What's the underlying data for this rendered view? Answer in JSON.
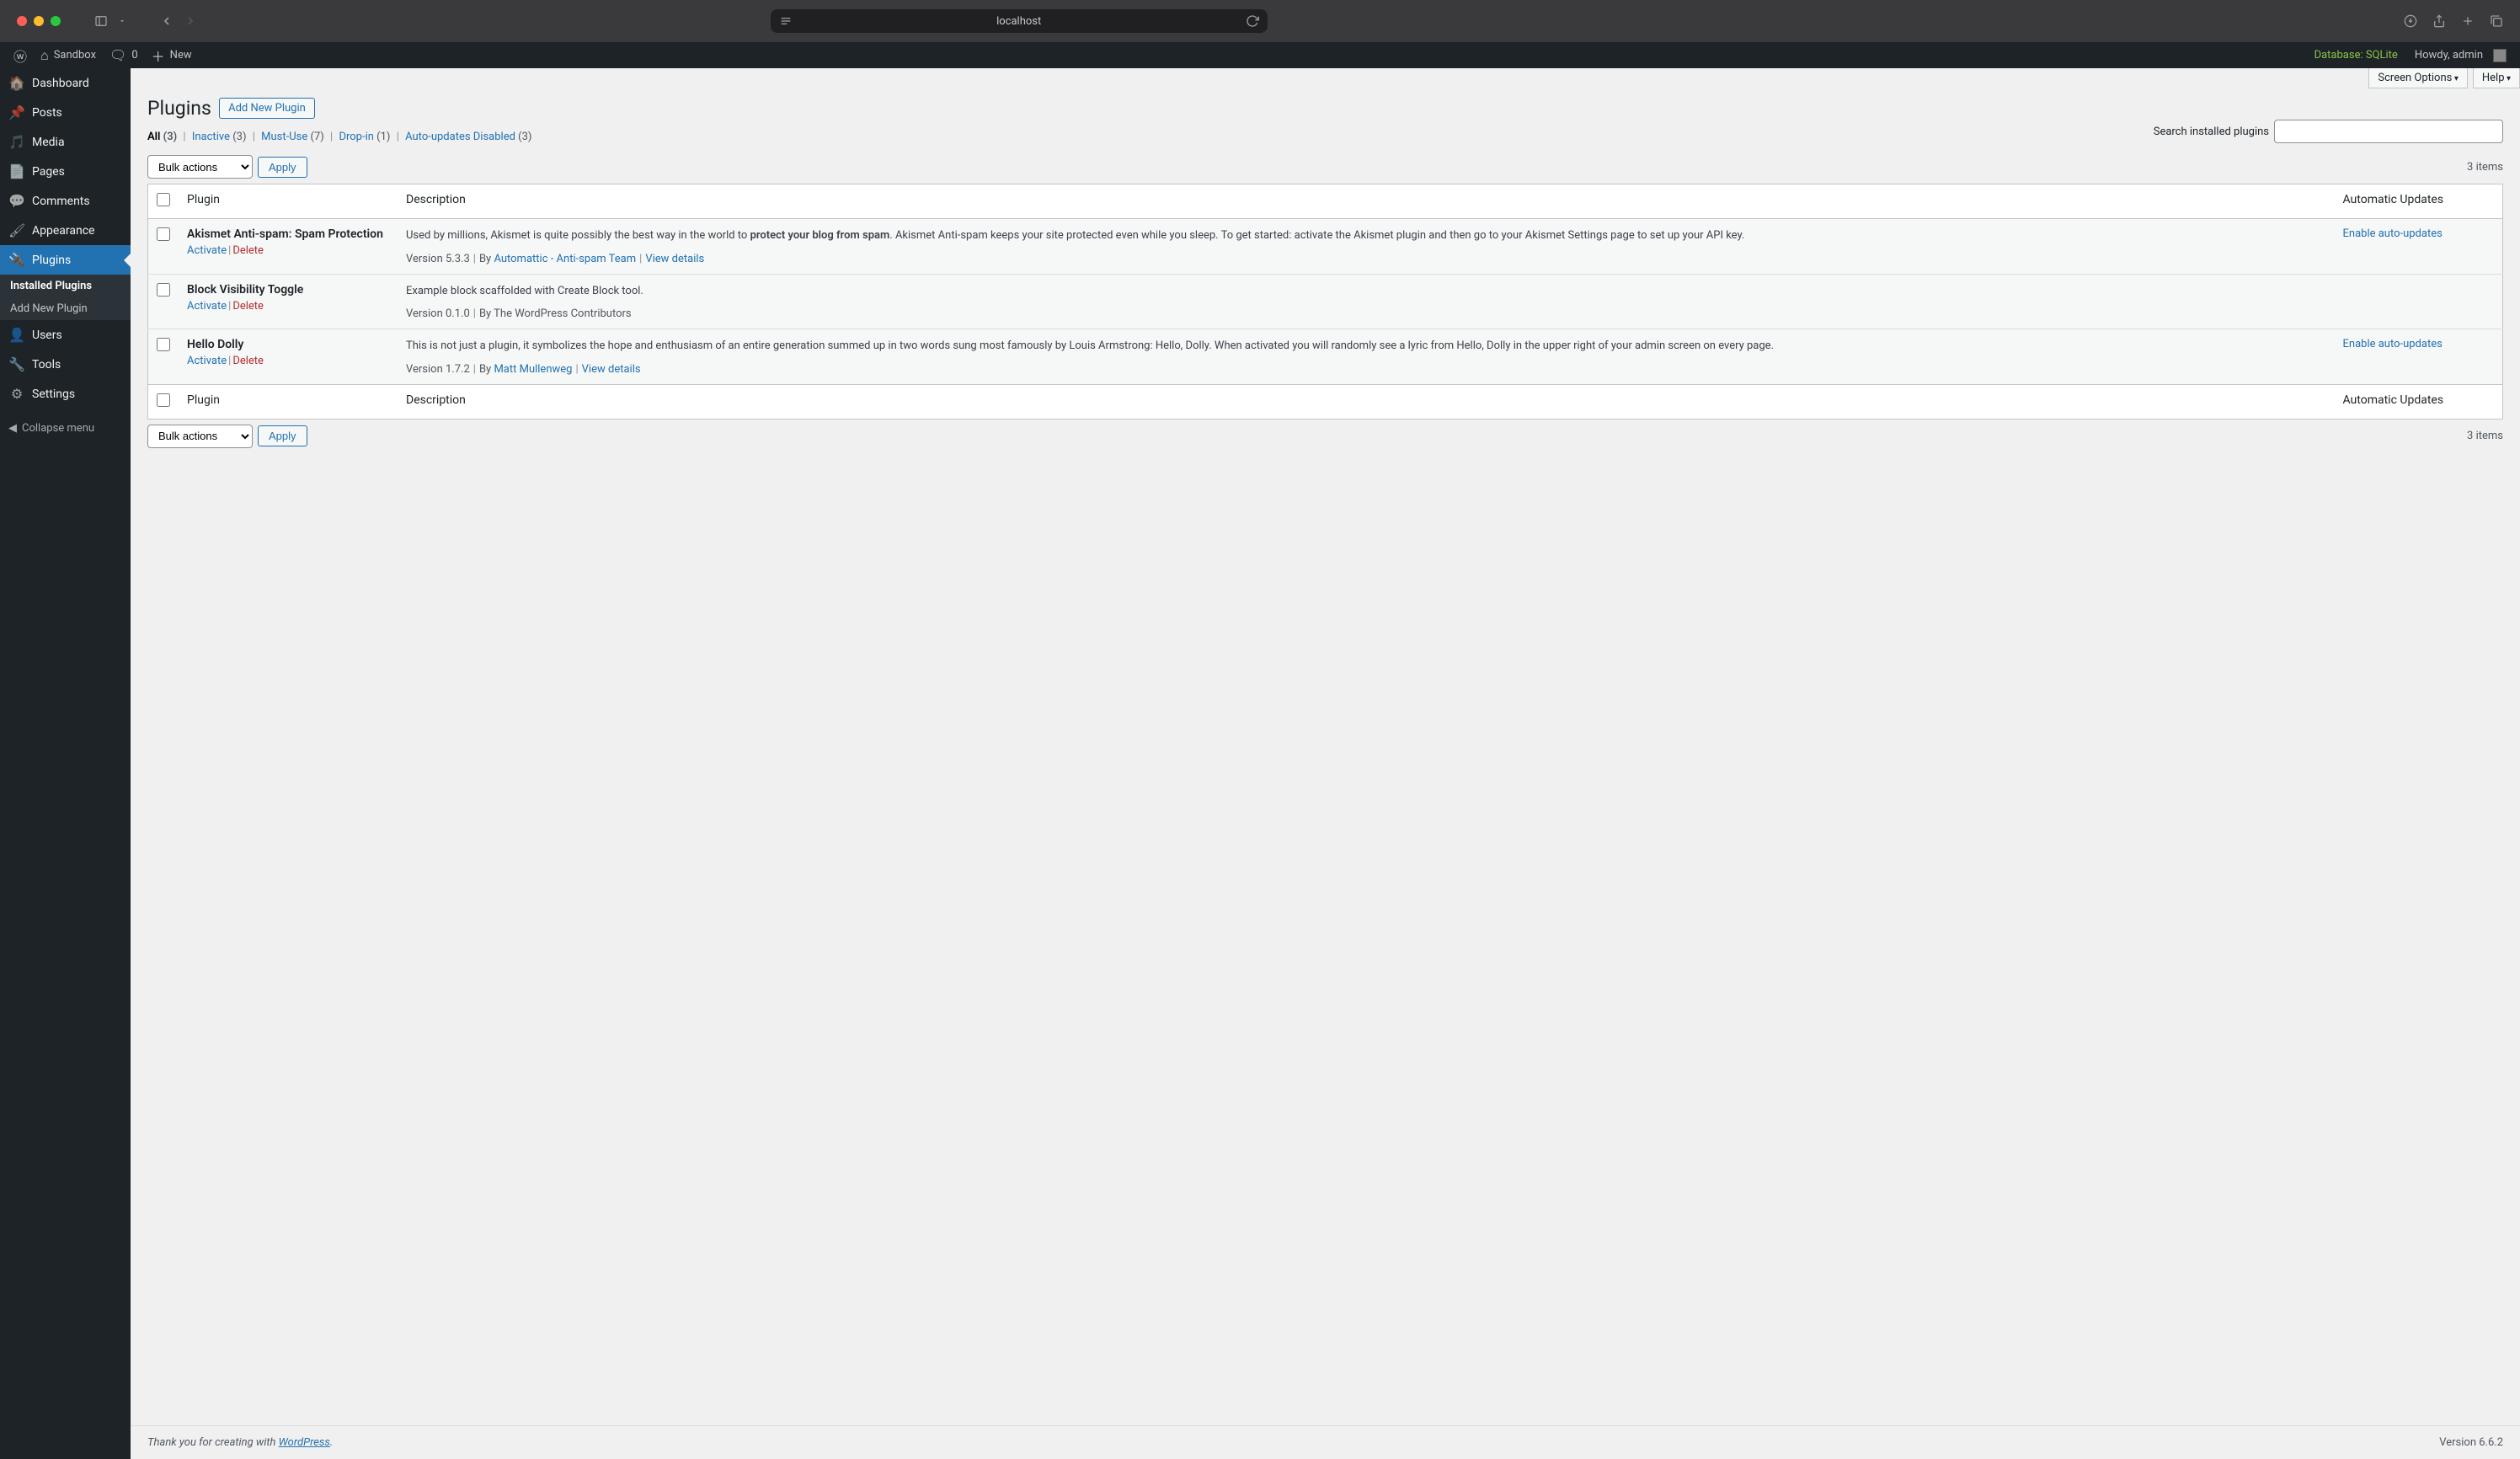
{
  "browser": {
    "url": "localhost"
  },
  "adminbar": {
    "site": "Sandbox",
    "comments": "0",
    "new": "New",
    "database": "Database: SQLite",
    "howdy": "Howdy, admin"
  },
  "sidebar": {
    "items": [
      {
        "label": "Dashboard",
        "icon": "⌂"
      },
      {
        "label": "Posts",
        "icon": "📌"
      },
      {
        "label": "Media",
        "icon": "🖼"
      },
      {
        "label": "Pages",
        "icon": "📄"
      },
      {
        "label": "Comments",
        "icon": "💬"
      },
      {
        "label": "Appearance",
        "icon": "🖌"
      },
      {
        "label": "Plugins",
        "icon": "🔌"
      },
      {
        "label": "Users",
        "icon": "👤"
      },
      {
        "label": "Tools",
        "icon": "🔧"
      },
      {
        "label": "Settings",
        "icon": "⚙"
      }
    ],
    "submenu": {
      "installed": "Installed Plugins",
      "addnew": "Add New Plugin"
    },
    "collapse": "Collapse menu"
  },
  "top_tabs": {
    "screen": "Screen Options",
    "help": "Help"
  },
  "page": {
    "title": "Plugins",
    "add_new": "Add New Plugin"
  },
  "filters": {
    "all_label": "All",
    "all_count": "(3)",
    "inactive_label": "Inactive",
    "inactive_count": "(3)",
    "mustuse_label": "Must-Use",
    "mustuse_count": "(7)",
    "dropin_label": "Drop-in",
    "dropin_count": "(1)",
    "autodis_label": "Auto-updates Disabled",
    "autodis_count": "(3)"
  },
  "search": {
    "label": "Search installed plugins"
  },
  "bulk": {
    "label": "Bulk actions",
    "apply": "Apply"
  },
  "items_count": "3 items",
  "table": {
    "col_plugin": "Plugin",
    "col_desc": "Description",
    "col_auto": "Automatic Updates"
  },
  "actions": {
    "activate": "Activate",
    "delete": "Delete",
    "enable_auto": "Enable auto-updates",
    "view_details": "View details"
  },
  "plugins": [
    {
      "name": "Akismet Anti-spam: Spam Protection",
      "desc_pre": "Used by millions, Akismet is quite possibly the best way in the world to ",
      "desc_strong": "protect your blog from spam",
      "desc_post": ". Akismet Anti-spam keeps your site protected even while you sleep. To get started: activate the Akismet plugin and then go to your Akismet Settings page to set up your API key.",
      "version": "Version 5.3.3",
      "by": "By ",
      "author": "Automattic - Anti-spam Team",
      "has_details": true,
      "has_auto": true
    },
    {
      "name": "Block Visibility Toggle",
      "desc": "Example block scaffolded with Create Block tool.",
      "version": "Version 0.1.0",
      "by_text": "By The WordPress Contributors",
      "has_details": false,
      "has_auto": false
    },
    {
      "name": "Hello Dolly",
      "desc": "This is not just a plugin, it symbolizes the hope and enthusiasm of an entire generation summed up in two words sung most famously by Louis Armstrong: Hello, Dolly. When activated you will randomly see a lyric from Hello, Dolly in the upper right of your admin screen on every page.",
      "version": "Version 1.7.2",
      "by": "By ",
      "author": "Matt Mullenweg",
      "has_details": true,
      "has_auto": true
    }
  ],
  "footer": {
    "thanks_pre": "Thank you for creating with ",
    "wp": "WordPress",
    "dot": ".",
    "version": "Version 6.6.2"
  }
}
